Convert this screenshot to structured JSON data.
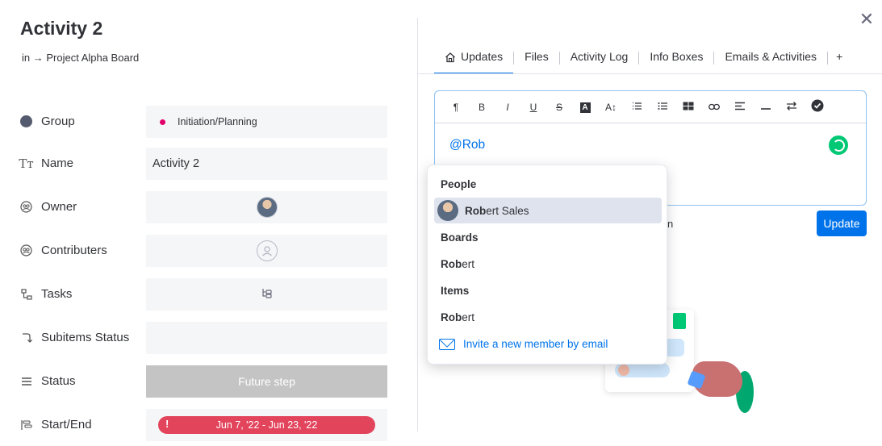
{
  "item": {
    "title": "Activity 2",
    "breadcrumb": "in → Project Alpha Board"
  },
  "fields": {
    "group": {
      "label": "Group",
      "value": "Initiation/Planning",
      "color": "#e2006a"
    },
    "name": {
      "label": "Name",
      "value": "Activity 2"
    },
    "owner": {
      "label": "Owner"
    },
    "contributers": {
      "label": "Contributers"
    },
    "tasks": {
      "label": "Tasks"
    },
    "subitems_status": {
      "label": "Subitems Status"
    },
    "status": {
      "label": "Status",
      "value": "Future step",
      "color": "#c4c4c4"
    },
    "start_end": {
      "label": "Start/End",
      "value": "Jun 7, '22 - Jun 23, '22",
      "color": "#e2445c",
      "alert": "!"
    }
  },
  "tabs": [
    {
      "label": "Updates",
      "active": true,
      "icon": "home-icon"
    },
    {
      "label": "Files"
    },
    {
      "label": "Activity Log"
    },
    {
      "label": "Info Boxes"
    },
    {
      "label": "Emails & Activities"
    },
    {
      "label": "+"
    }
  ],
  "toolbar": [
    "¶",
    "B",
    "I",
    "U",
    "S",
    "A",
    "A↕",
    "list-numbered",
    "list-bulleted",
    "checklist",
    "link",
    "align",
    "divider",
    "direction",
    "check"
  ],
  "editor": {
    "text": "@Rob",
    "partial_hint": "n"
  },
  "update_button": "Update",
  "mentions": {
    "people_header": "People",
    "people": [
      {
        "match": "Rob",
        "rest": "ert Sales"
      }
    ],
    "boards_header": "Boards",
    "boards": [
      {
        "match": "Rob",
        "rest": "ert"
      }
    ],
    "items_header": "Items",
    "items": [
      {
        "match": "Rob",
        "rest": "ert"
      }
    ],
    "invite": "Invite a new member by email"
  },
  "colors": {
    "accent": "#0073ea",
    "success": "#00c875"
  }
}
